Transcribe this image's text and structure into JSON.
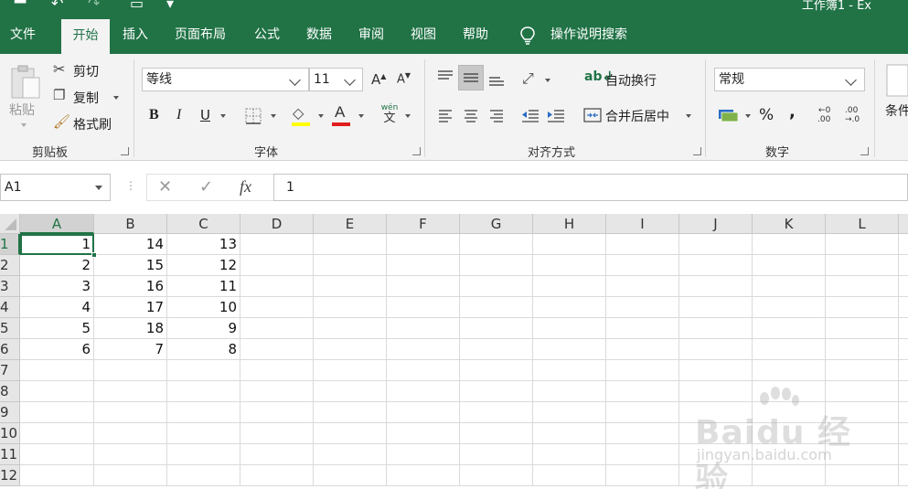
{
  "window": {
    "title_partial": "工作簿1 - Ex",
    "quick_access": [
      "save-icon",
      "undo-icon",
      "redo-icon",
      "form-icon",
      "customize-icon"
    ]
  },
  "tabs": [
    {
      "label": "文件",
      "active": false
    },
    {
      "label": "开始",
      "active": true
    },
    {
      "label": "插入",
      "active": false
    },
    {
      "label": "页面布局",
      "active": false
    },
    {
      "label": "公式",
      "active": false
    },
    {
      "label": "数据",
      "active": false
    },
    {
      "label": "审阅",
      "active": false
    },
    {
      "label": "视图",
      "active": false
    },
    {
      "label": "帮助",
      "active": false
    }
  ],
  "search": {
    "label": "操作说明搜索",
    "icon": "lightbulb-icon"
  },
  "ribbon": {
    "clipboard": {
      "group_label": "剪贴板",
      "paste": "粘贴",
      "cut": "剪切",
      "copy": "复制",
      "format_painter": "格式刷"
    },
    "font": {
      "group_label": "字体",
      "font_name": "等线",
      "font_size": "11",
      "bold": "B",
      "italic": "I",
      "underline": "U",
      "highlight_color": "#ffff00",
      "font_color": "#e11d1d",
      "phonetic_top": "wén",
      "phonetic_bottom": "文"
    },
    "alignment": {
      "group_label": "对齐方式",
      "wrap_text": "自动换行",
      "merge_center": "合并后居中"
    },
    "number": {
      "group_label": "数字",
      "format": "常规",
      "percent": "%",
      "comma": ",",
      "inc_decimal_top": "←0",
      "inc_decimal_bottom": ".00",
      "dec_decimal_top": ".00",
      "dec_decimal_bottom": "→.0"
    },
    "styles": {
      "partial_label": "条件"
    }
  },
  "formula_bar": {
    "name_box": "A1",
    "cancel": "✕",
    "enter": "✓",
    "fx": "fx",
    "content": "1"
  },
  "sheet": {
    "columns": [
      "A",
      "B",
      "C",
      "D",
      "E",
      "F",
      "G",
      "H",
      "I",
      "J",
      "K",
      "L"
    ],
    "rows": [
      "1",
      "2",
      "3",
      "4",
      "5",
      "6",
      "7",
      "8",
      "9",
      "10",
      "11",
      "12"
    ],
    "data": [
      [
        "1",
        "14",
        "13"
      ],
      [
        "2",
        "15",
        "12"
      ],
      [
        "3",
        "16",
        "11"
      ],
      [
        "4",
        "17",
        "10"
      ],
      [
        "5",
        "18",
        "9"
      ],
      [
        "6",
        "7",
        "8"
      ]
    ],
    "active_cell": "A1"
  },
  "watermark": {
    "brand": "Baidu 经验",
    "url": "jingyan.baidu.com"
  },
  "colors": {
    "accent": "#217346",
    "ribbon_bg": "#f3f3f3",
    "header_bg": "#e6e6e6"
  }
}
